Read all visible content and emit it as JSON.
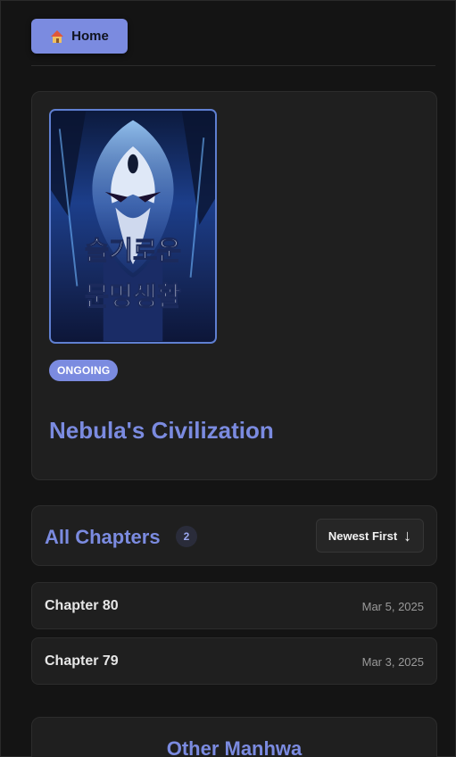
{
  "nav": {
    "home_label": "Home"
  },
  "series": {
    "cover_text_line1": "슬기로운",
    "cover_text_line2": "문명생활",
    "status": "ONGOING",
    "title": "Nebula's Civilization"
  },
  "chapters": {
    "heading": "All Chapters",
    "count": "2",
    "sort_label": "Newest First",
    "sort_arrow": "↓",
    "items": [
      {
        "name": "Chapter 80",
        "date": "Mar 5, 2025"
      },
      {
        "name": "Chapter 79",
        "date": "Mar 3, 2025"
      }
    ]
  },
  "other": {
    "heading": "Other Manhwa"
  },
  "colors": {
    "accent": "#7b8be0",
    "background": "#141414",
    "card": "#1f1f1f"
  }
}
